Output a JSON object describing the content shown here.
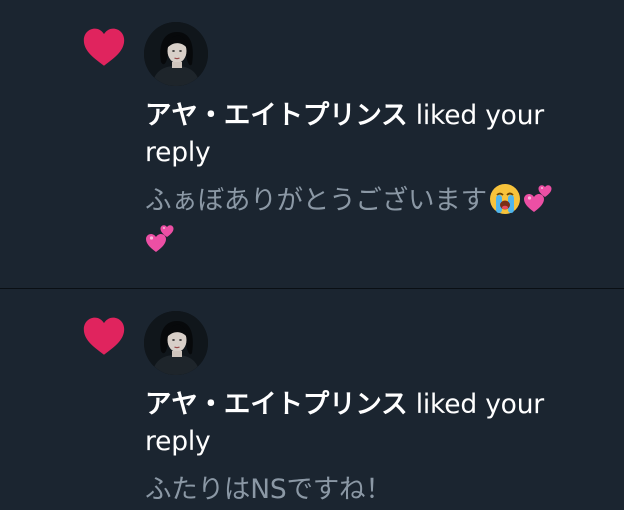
{
  "notifications": [
    {
      "author": "アヤ・エイトプリンス",
      "action": "liked your reply",
      "reply_text": "ふぁぼありがとうございます",
      "emojis": [
        "loudly-crying-face",
        "two-hearts",
        "two-hearts"
      ]
    },
    {
      "author": "アヤ・エイトプリンス",
      "action": "liked your reply",
      "reply_text": "ふたりはNSですね！",
      "emojis": []
    }
  ],
  "colors": {
    "background": "#1b2530",
    "heart": "#e0245e",
    "primary_text": "#ffffff",
    "secondary_text": "#8b98a5",
    "divider": "#0a0f14"
  },
  "icons": {
    "notification_type": "heart-icon",
    "avatar": "profile-avatar"
  }
}
